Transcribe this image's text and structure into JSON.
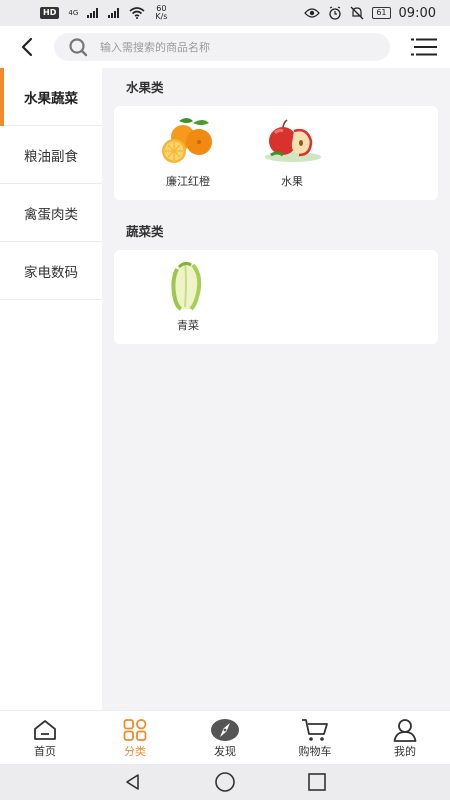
{
  "status_bar": {
    "hd": "HD",
    "network": "4G",
    "speed_value": "60",
    "speed_unit": "K/s",
    "battery": "61",
    "time": "09:00"
  },
  "header": {
    "search_placeholder": "输入需搜索的商品名称",
    "back_icon": "chevron-left-icon",
    "menu_icon": "list-menu-icon"
  },
  "sidebar": {
    "items": [
      {
        "label": "水果蔬菜",
        "active": true
      },
      {
        "label": "粮油副食",
        "active": false
      },
      {
        "label": "禽蛋肉类",
        "active": false
      },
      {
        "label": "家电数码",
        "active": false
      }
    ]
  },
  "sections": [
    {
      "title": "水果类",
      "items": [
        {
          "name": "廉江红橙",
          "image": "orange-image"
        },
        {
          "name": "水果",
          "image": "apple-image"
        }
      ]
    },
    {
      "title": "蔬菜类",
      "items": [
        {
          "name": "青菜",
          "image": "cabbage-image"
        }
      ]
    }
  ],
  "tabbar": {
    "tabs": [
      {
        "label": "首页",
        "icon": "home-icon",
        "active": false
      },
      {
        "label": "分类",
        "icon": "category-grid-icon",
        "active": true
      },
      {
        "label": "发现",
        "icon": "compass-icon",
        "active": false
      },
      {
        "label": "购物车",
        "icon": "cart-icon",
        "active": false
      },
      {
        "label": "我的",
        "icon": "user-icon",
        "active": false
      }
    ]
  },
  "colors": {
    "accent": "#f08a2b",
    "background": "#f3f3f6"
  }
}
